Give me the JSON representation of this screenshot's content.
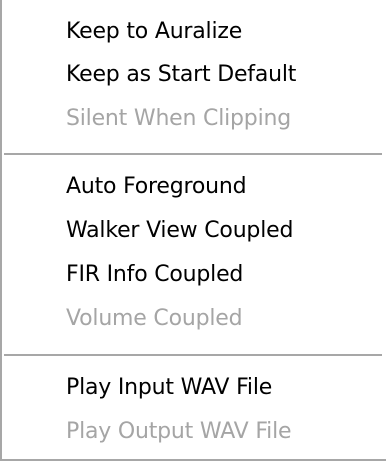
{
  "menu": {
    "groups": [
      {
        "items": [
          {
            "label": "Keep to Auralize",
            "enabled": true
          },
          {
            "label": "Keep as Start Default",
            "enabled": true
          },
          {
            "label": "Silent When Clipping",
            "enabled": false
          }
        ]
      },
      {
        "items": [
          {
            "label": "Auto Foreground",
            "enabled": true
          },
          {
            "label": "Walker View Coupled",
            "enabled": true
          },
          {
            "label": "FIR Info Coupled",
            "enabled": true
          },
          {
            "label": "Volume Coupled",
            "enabled": false
          }
        ]
      },
      {
        "items": [
          {
            "label": "Play Input WAV File",
            "enabled": true
          },
          {
            "label": "Play Output WAV File",
            "enabled": false
          }
        ]
      }
    ]
  }
}
